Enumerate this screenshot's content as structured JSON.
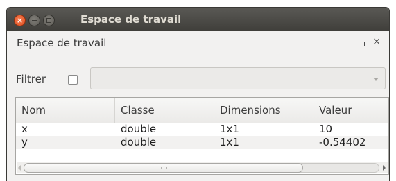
{
  "window": {
    "title": "Espace de travail"
  },
  "panel": {
    "title": "Espace de travail",
    "close_glyph": "×"
  },
  "filter": {
    "label": "Filtrer",
    "checked": false,
    "combo_value": ""
  },
  "table": {
    "columns": [
      "Nom",
      "Classe",
      "Dimensions",
      "Valeur"
    ],
    "rows": [
      [
        "x",
        "double",
        "1x1",
        "10"
      ],
      [
        "y",
        "double",
        "1x1",
        "-0.54402"
      ]
    ]
  },
  "icons": {
    "close": "close-icon",
    "minimize": "minimize-icon",
    "maximize": "maximize-icon",
    "undock": "undock-icon",
    "combo_arrow": "chevron-down-icon",
    "scroll_left": "arrow-left-icon",
    "scroll_right": "arrow-right-icon"
  },
  "colors": {
    "titlebar": "#3f3e3a",
    "close_button": "#dc4c1d",
    "panel_background": "#f2f1f0"
  }
}
